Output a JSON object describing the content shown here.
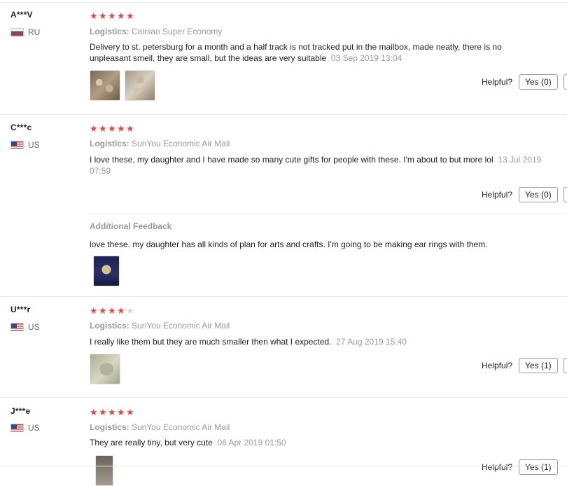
{
  "reviews": [
    {
      "user": "A***V",
      "country": "RU",
      "rating": 5,
      "logistics_label": "Logistics:",
      "logistics": "Cainiao Super Economy",
      "text": "Delivery to st. petersburg for a month and a half track is not tracked put in the mailbox, made neatly, there is no unpleasant smell, they are small, but the ideas are very suitable",
      "date": "03 Sep 2019 13:04",
      "helpful_label": "Helpful?",
      "yes_label": "Yes (0)"
    },
    {
      "user": "C***c",
      "country": "US",
      "rating": 5,
      "logistics_label": "Logistics:",
      "logistics": "SunYou Economic Air Mail",
      "text": "I love these, my daughter and I have made so many cute gifts for people with these. I'm about to but more lol",
      "date": "13 Jul 2019 07:59",
      "helpful_label": "Helpful?",
      "yes_label": "Yes (0)",
      "additional_title": "Additional Feedback",
      "additional_text": "love these. my daughter has all kinds of plan for arts and crafts. I'm going to be making ear rings with them."
    },
    {
      "user": "U***r",
      "country": "US",
      "rating": 4,
      "logistics_label": "Logistics:",
      "logistics": "SunYou Economic Air Mail",
      "text": "I really like them but they are much smaller then what I expected.",
      "date": "27 Aug 2019 15:40",
      "helpful_label": "Helpful?",
      "yes_label": "Yes (1)"
    },
    {
      "user": "J***e",
      "country": "US",
      "rating": 5,
      "logistics_label": "Logistics:",
      "logistics": "SunYou Economic Air Mail",
      "text": "They are really tiny, but very cute",
      "date": "06 Apr 2019 01:50",
      "helpful_label": "Helpful?",
      "yes_label": "Yes (1)"
    }
  ],
  "colors": {
    "star_on": "#e64545",
    "star_off": "#d8d8d8",
    "muted_text": "#999999",
    "separator": "#e8e8e8"
  },
  "icons": {
    "star": "star-icon",
    "flag_ru": "flag-ru-icon",
    "flag_us": "flag-us-icon"
  }
}
